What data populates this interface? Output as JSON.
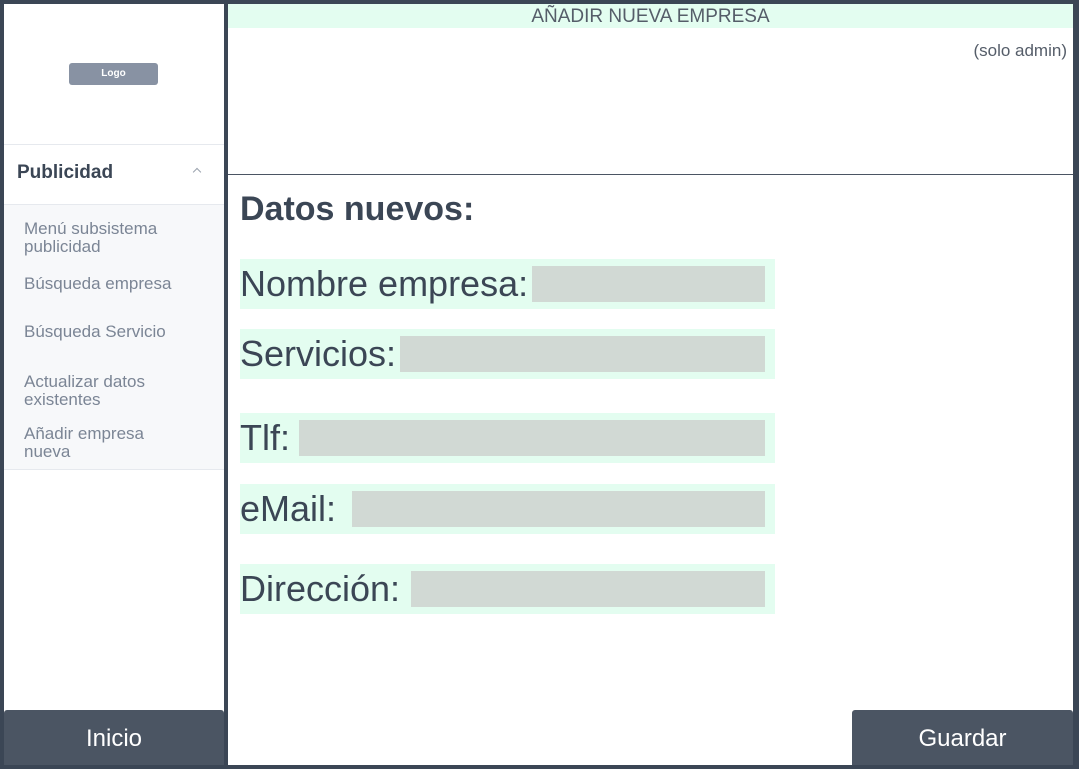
{
  "sidebar": {
    "logo_label": "Logo",
    "section_label": "Publicidad",
    "items": [
      {
        "label": "Menú subsistema publicidad"
      },
      {
        "label": "Búsqueda empresa"
      },
      {
        "label": "Búsqueda Servicio"
      },
      {
        "label": "Actualizar datos existentes"
      },
      {
        "label": "Añadir empresa nueva"
      }
    ],
    "home_label": "Inicio"
  },
  "main": {
    "title": "AÑADIR NUEVA EMPRESA",
    "admin_note": "(solo admin)",
    "section_title": "Datos nuevos:",
    "fields": [
      {
        "label": "Nombre empresa:",
        "value": ""
      },
      {
        "label": "Servicios:",
        "value": ""
      },
      {
        "label": "Tlf:",
        "value": ""
      },
      {
        "label": "eMail:",
        "value": ""
      },
      {
        "label": "Dirección:",
        "value": ""
      }
    ],
    "save_label": "Guardar"
  },
  "colors": {
    "frame": "#3b4655",
    "accent_mint": "#e3fdf0",
    "input_fill": "#d1d9d4",
    "button": "#4b5563"
  }
}
